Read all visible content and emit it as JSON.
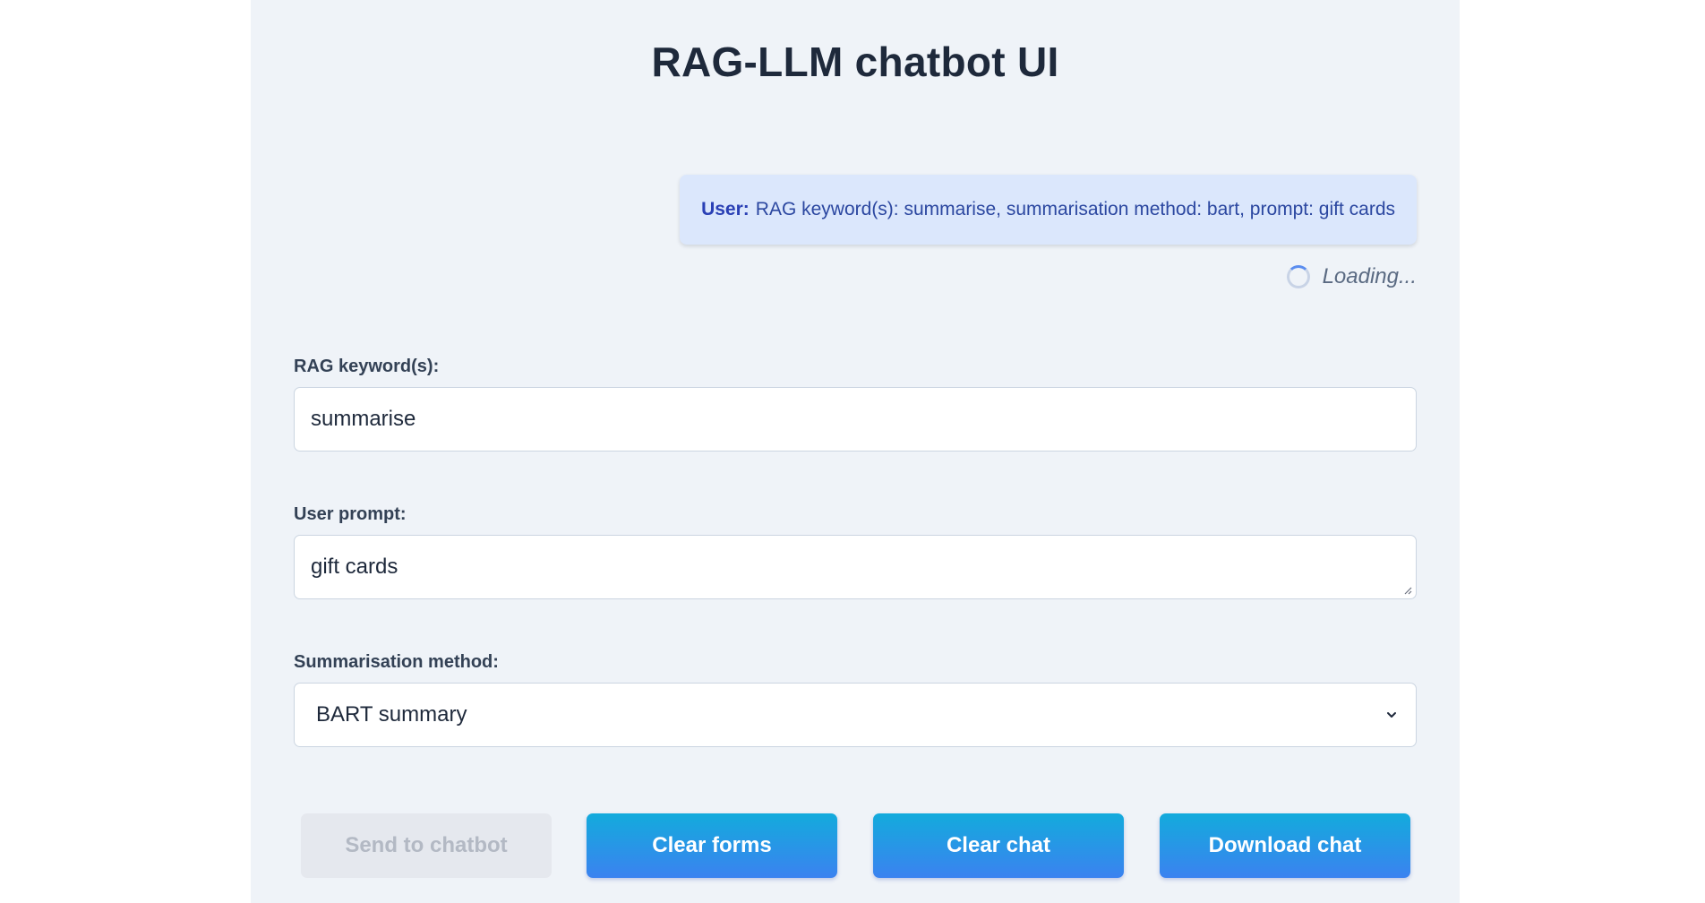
{
  "page": {
    "title": "RAG-LLM chatbot UI"
  },
  "chat": {
    "messages": [
      {
        "speaker": "User:",
        "text": "RAG keyword(s): summarise, summarisation method: bart, prompt: gift cards"
      }
    ],
    "loading_text": "Loading..."
  },
  "form": {
    "rag_keywords": {
      "label": "RAG keyword(s):",
      "value": "summarise"
    },
    "user_prompt": {
      "label": "User prompt:",
      "value": "gift cards"
    },
    "summarisation_method": {
      "label": "Summarisation method:",
      "selected": "BART summary"
    }
  },
  "buttons": {
    "send": {
      "label": "Send to chatbot",
      "disabled": true
    },
    "clear_forms": {
      "label": "Clear forms"
    },
    "clear_chat": {
      "label": "Clear chat"
    },
    "download_chat": {
      "label": "Download chat"
    }
  },
  "colors": {
    "panel_background": "#eff3f8",
    "user_bubble": "#dbe7fc",
    "button_gradient_top": "#13abdc",
    "button_gradient_bottom": "#3b82f0",
    "disabled_button": "#e5e8ee"
  },
  "icons": {
    "loading": "spinner-icon",
    "select": "chevron-down-icon",
    "textarea_resize": "resize-handle-icon"
  }
}
